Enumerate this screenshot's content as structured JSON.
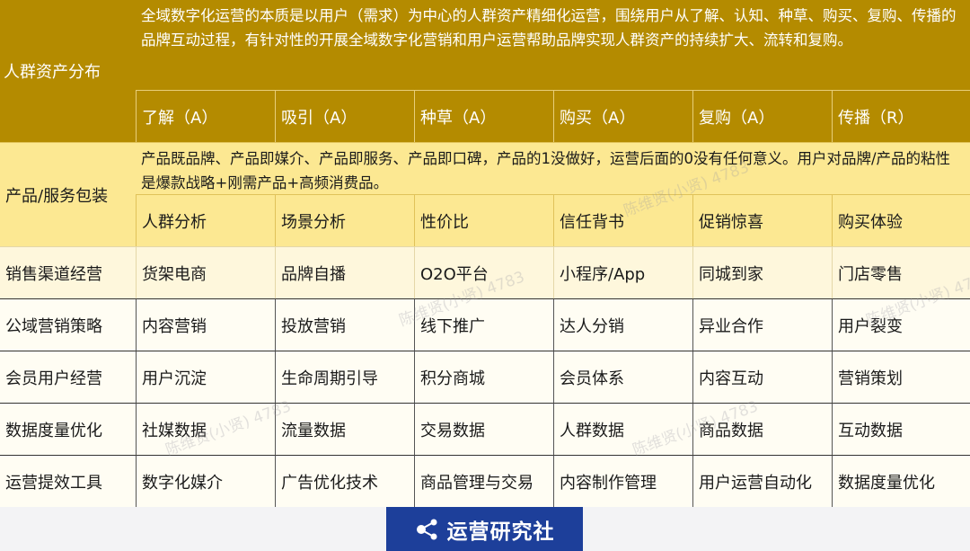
{
  "header": {
    "label": "人群资产分布",
    "description": "全域数字化运营的本质是以用户（需求）为中心的人群资产精细化运营，围绕用户从了解、认知、种草、购买、复购、传播的品牌互动过程，有针对性的开展全域数字化营销和用户运营帮助品牌实现人群资产的持续扩大、流转和复购。",
    "stages": [
      "了解（A）",
      "吸引（A）",
      "种草（A）",
      "购买（A）",
      "复购（A）",
      "传播（R）"
    ]
  },
  "product": {
    "label": "产品/服务包装",
    "description": "产品既品牌、产品即媒介、产品即服务、产品即口碑，产品的1没做好，运营后面的0没有任何意义。用户对品牌/产品的粘性是爆款战略+刚需产品+高频消费品。",
    "items": [
      "人群分析",
      "场景分析",
      "性价比",
      "信任背书",
      "促销惊喜",
      "购买体验"
    ]
  },
  "rows": [
    {
      "label": "销售渠道经营",
      "items": [
        "货架电商",
        "品牌自播",
        "O2O平台",
        "小程序/App",
        "同城到家",
        "门店零售"
      ]
    },
    {
      "label": "公域营销策略",
      "items": [
        "内容营销",
        "投放营销",
        "线下推广",
        "达人分销",
        "异业合作",
        "用户裂变"
      ]
    },
    {
      "label": "会员用户经营",
      "items": [
        "用户沉淀",
        "生命周期引导",
        "积分商城",
        "会员体系",
        "内容互动",
        "营销策划"
      ]
    },
    {
      "label": "数据度量优化",
      "items": [
        "社媒数据",
        "流量数据",
        "交易数据",
        "人群数据",
        "商品数据",
        "互动数据"
      ]
    },
    {
      "label": "运营提效工具",
      "items": [
        "数字化媒介",
        "广告优化技术",
        "商品管理与交易",
        "内容制作管理",
        "用户运营自动化",
        "数据度量优化"
      ]
    }
  ],
  "watermark": "陈维贤(小贤) 4783",
  "logo": {
    "text": "运营研究社",
    "icon": "share-nodes-icon"
  },
  "colors": {
    "gold": "#b48b00",
    "yellow": "#fce892",
    "light_yellow": "#fef7dc",
    "logo_blue": "#1d3f9a"
  }
}
